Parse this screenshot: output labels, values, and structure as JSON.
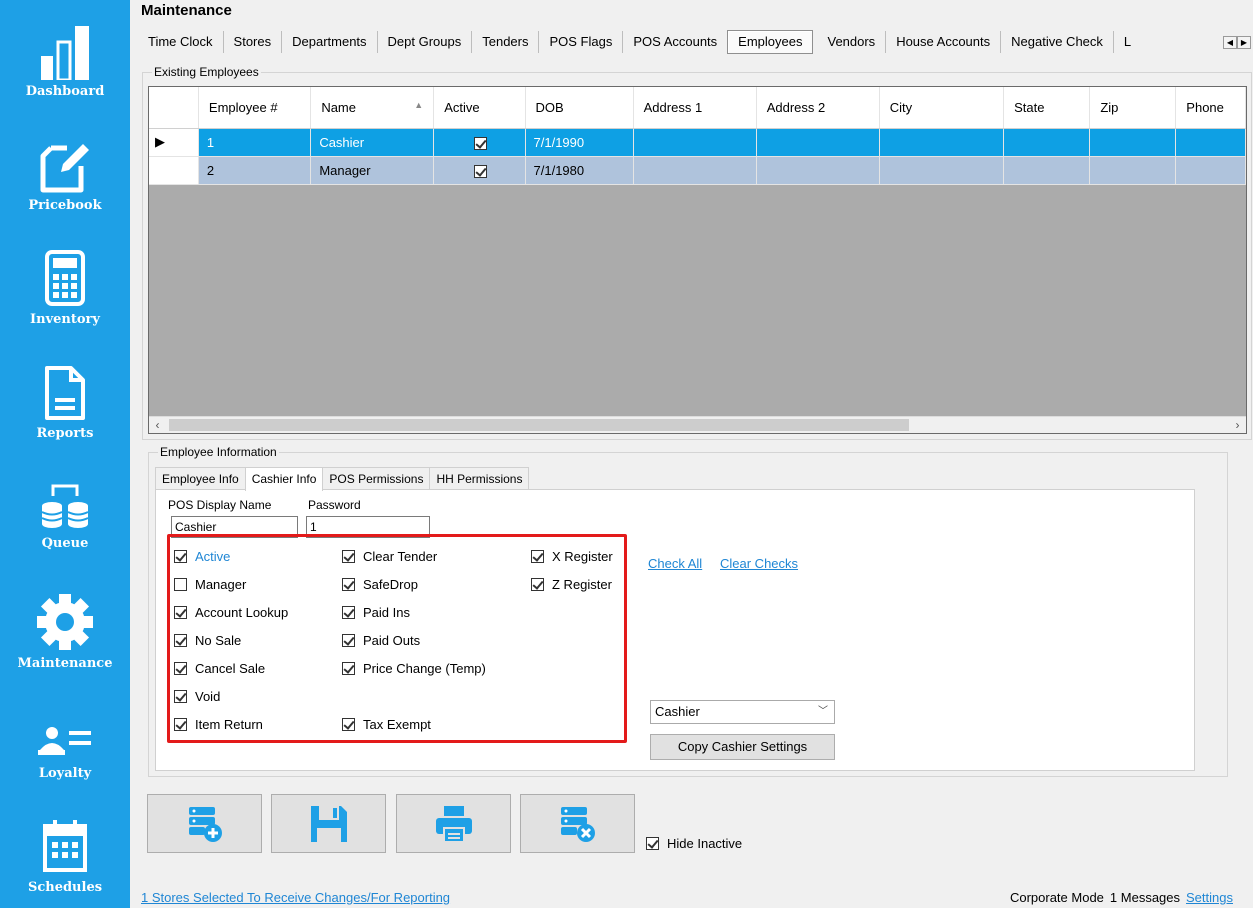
{
  "sidebar": {
    "items": [
      {
        "label": "Dashboard"
      },
      {
        "label": "Pricebook"
      },
      {
        "label": "Inventory"
      },
      {
        "label": "Reports"
      },
      {
        "label": "Queue"
      },
      {
        "label": "Maintenance"
      },
      {
        "label": "Loyalty"
      },
      {
        "label": "Schedules"
      }
    ],
    "bg_color": "#1ea0e6"
  },
  "page": {
    "title": "Maintenance"
  },
  "tabs": [
    {
      "label": "Time Clock"
    },
    {
      "label": "Stores"
    },
    {
      "label": "Departments"
    },
    {
      "label": "Dept Groups"
    },
    {
      "label": "Tenders"
    },
    {
      "label": "POS Flags"
    },
    {
      "label": "POS Accounts"
    },
    {
      "label": "Employees",
      "active": true
    },
    {
      "label": "Vendors"
    },
    {
      "label": "House Accounts"
    },
    {
      "label": "Negative Check"
    },
    {
      "label": "L"
    }
  ],
  "existing": {
    "group_label": "Existing Employees",
    "columns": [
      "Employee #",
      "Name",
      "Active",
      "DOB",
      "Address 1",
      "Address 2",
      "City",
      "State",
      "Zip",
      "Phone"
    ],
    "rows": [
      {
        "id": "1",
        "name": "Cashier",
        "active": true,
        "dob": "7/1/1990"
      },
      {
        "id": "2",
        "name": "Manager",
        "active": true,
        "dob": "7/1/1980"
      }
    ]
  },
  "info": {
    "group_label": "Employee Information",
    "tabs": [
      "Employee Info",
      "Cashier Info",
      "POS Permissions",
      "HH Permissions"
    ],
    "display_name_label": "POS Display Name",
    "display_name_value": "Cashier",
    "password_label": "Password",
    "password_value": "1",
    "permissions": [
      {
        "label": "Active",
        "checked": true,
        "link_style": true
      },
      {
        "label": "Manager",
        "checked": false
      },
      {
        "label": "Account Lookup",
        "checked": true
      },
      {
        "label": "No Sale",
        "checked": true
      },
      {
        "label": "Cancel Sale",
        "checked": true
      },
      {
        "label": "Void",
        "checked": true
      },
      {
        "label": "Item Return",
        "checked": true
      },
      {
        "label": "Clear Tender",
        "checked": true
      },
      {
        "label": "SafeDrop",
        "checked": true
      },
      {
        "label": "Paid Ins",
        "checked": true
      },
      {
        "label": "Paid Outs",
        "checked": true
      },
      {
        "label": "Price Change (Temp)",
        "checked": true
      },
      {
        "label": "Tax Exempt",
        "checked": true
      },
      {
        "label": "X Register",
        "checked": true
      },
      {
        "label": "Z Register",
        "checked": true
      }
    ],
    "check_all": "Check All",
    "clear_checks": "Clear Checks",
    "copy_select_value": "Cashier",
    "copy_button": "Copy Cashier Settings"
  },
  "hide_inactive": {
    "label": "Hide Inactive",
    "checked": true
  },
  "status": {
    "stores_link": "1 Stores Selected To Receive Changes/For Reporting",
    "mode": "Corporate Mode",
    "messages": "1 Messages",
    "settings": "Settings"
  },
  "colors": {
    "accent": "#1ea0e6",
    "selected_row": "#0ea0e4",
    "alt_row": "#afc3dc",
    "highlight_border": "#e31a1a",
    "link": "#1f86d4"
  }
}
